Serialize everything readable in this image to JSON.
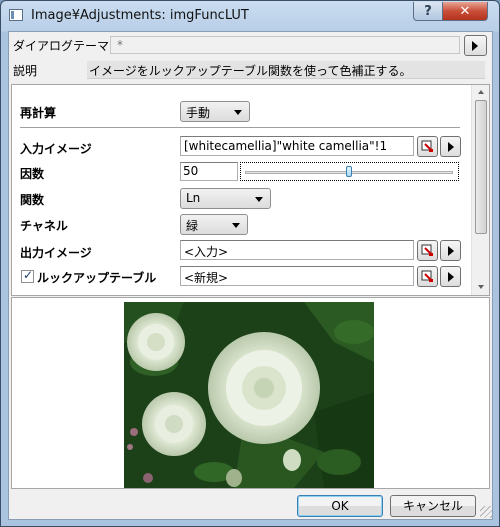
{
  "window": {
    "title": "Image¥Adjustments: imgFuncLUT",
    "help_glyph": "?",
    "close_glyph": "✕"
  },
  "header": {
    "theme_label": "ダイアログテーマ",
    "theme_value": "*",
    "desc_label": "説明",
    "desc_text": "イメージをルックアップテーブル関数を使って色補正する。"
  },
  "form": {
    "recalc_label": "再計算",
    "recalc_value": "手動",
    "input_label": "入力イメージ",
    "input_value": "[whitecamellia]\"white camellia\"!1",
    "factor_label": "因数",
    "factor_value": "50",
    "factor_slider": 0.5,
    "function_label": "関数",
    "function_value": "Ln",
    "channel_label": "チャネル",
    "channel_value": "緑",
    "output_label": "出力イメージ",
    "output_value": "<入力>",
    "lut_label": "ルックアップテーブル",
    "lut_checked": true,
    "lut_value": "<新規>"
  },
  "buttons": {
    "ok": "OK",
    "cancel": "キャンセル"
  },
  "colors": {
    "accent": "#3c7fb1",
    "close_red": "#c9503a",
    "foliage": "#1f4a1a"
  },
  "icons": [
    "app-icon",
    "help-icon",
    "close-icon",
    "play-icon",
    "pick-icon",
    "checkbox-icon"
  ]
}
